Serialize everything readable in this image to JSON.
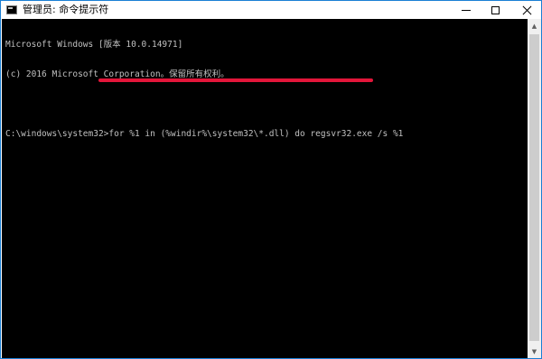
{
  "window": {
    "title": "管理员: 命令提示符",
    "icon": "cmd-icon"
  },
  "caption_buttons": {
    "minimize": "minimize-icon",
    "maximize": "maximize-icon",
    "close": "close-icon"
  },
  "console": {
    "lines": [
      "Microsoft Windows [版本 10.0.14971]",
      "(c) 2016 Microsoft Corporation。保留所有权利。",
      "",
      "C:\\windows\\system32>for %1 in (%windir%\\system32\\*.dll) do regsvr32.exe /s %1"
    ],
    "prompt": "C:\\windows\\system32>",
    "command": "for %1 in (%windir%\\system32\\*.dll) do regsvr32.exe /s %1",
    "text_color": "#c0c0c0",
    "background": "#000000",
    "highlight_color": "#e3163a"
  },
  "scrollbar": {
    "up_arrow": "▲",
    "down_arrow": "▼"
  }
}
